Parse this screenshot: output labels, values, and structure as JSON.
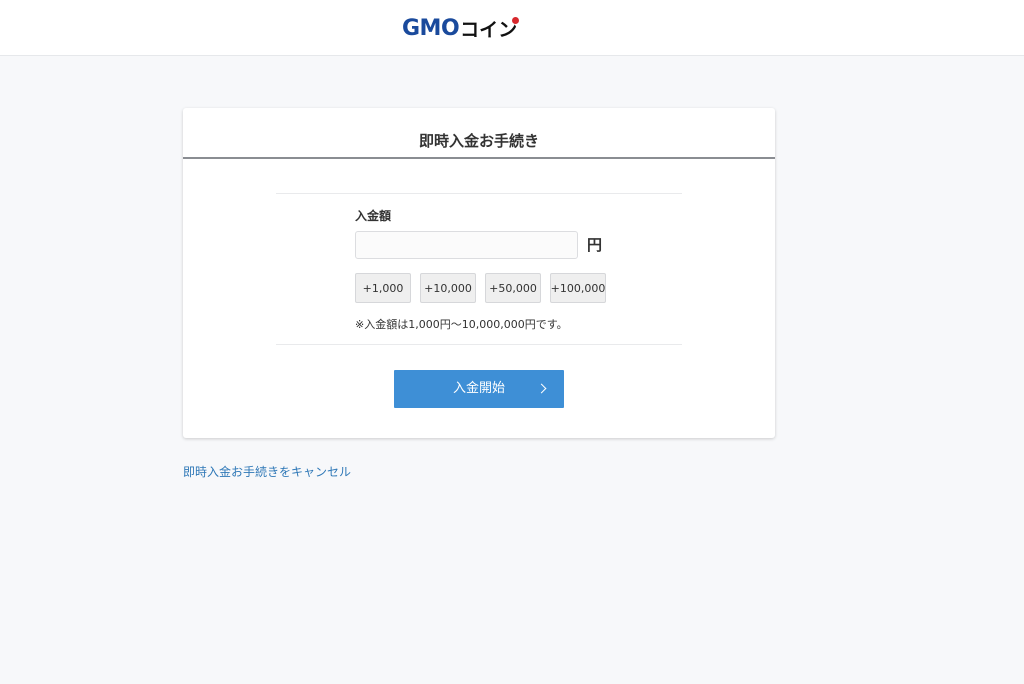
{
  "header": {
    "logo_gmo": "GMO",
    "logo_coin": "コイン"
  },
  "card": {
    "title": "即時入金お手続き",
    "amount_label": "入金額",
    "amount_input": {
      "value": "",
      "placeholder": ""
    },
    "unit": "円",
    "quick_buttons": [
      "+1,000",
      "+10,000",
      "+50,000",
      "+100,000"
    ],
    "note": "※入金額は1,000円〜10,000,000円です。",
    "submit_label": "入金開始"
  },
  "cancel_link": "即時入金お手続きをキャンセル",
  "colors": {
    "accent": "#3e8fd6",
    "brand_blue": "#1a4a9c",
    "brand_red": "#d7282d",
    "link": "#2f78b7"
  }
}
